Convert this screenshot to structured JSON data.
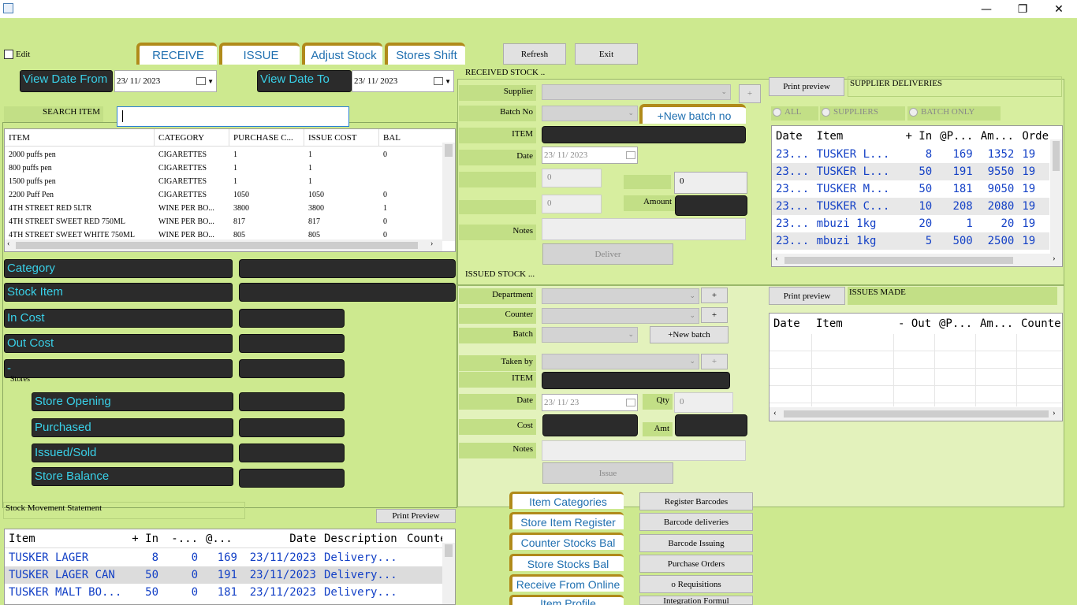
{
  "edit_label": "Edit",
  "tabs": [
    {
      "label": "RECEIVE"
    },
    {
      "label": "ISSUE"
    },
    {
      "label": "Adjust Stock"
    },
    {
      "label": "Stores Shift"
    }
  ],
  "top_buttons": {
    "refresh": "Refresh",
    "exit": "Exit"
  },
  "view_date_from": {
    "label": "View Date From",
    "value": "23/ 11/ 2023"
  },
  "view_date_to": {
    "label": "View Date To",
    "value": "23/ 11/ 2023"
  },
  "search_item": {
    "label": "SEARCH ITEM",
    "value": ""
  },
  "item_grid": {
    "columns": [
      "ITEM",
      "CATEGORY",
      "PURCHASE C...",
      "ISSUE COST",
      "BAL"
    ],
    "rows": [
      [
        "2000 puffs pen",
        "CIGARETTES",
        "1",
        "1",
        "0"
      ],
      [
        "800 puffs pen",
        "CIGARETTES",
        "1",
        "1",
        ""
      ],
      [
        "1500 puffs pen",
        "CIGARETTES",
        "1",
        "1",
        ""
      ],
      [
        "2200 Puff Pen",
        "CIGARETTES",
        "1050",
        "1050",
        "0"
      ],
      [
        "4TH STREET RED 5LTR",
        "WINE PER BO...",
        "3800",
        "3800",
        "1"
      ],
      [
        "4TH STREET SWEET RED 750ML",
        "WINE PER BO...",
        "817",
        "817",
        "0"
      ],
      [
        "4TH STREET SWEET WHITE 750ML",
        "WINE PER BO...",
        "805",
        "805",
        "0"
      ]
    ]
  },
  "detail_labels": {
    "category": "Category",
    "stock_item": "Stock Item",
    "in_cost": "In Cost",
    "out_cost": "Out Cost",
    "dash": "-",
    "stores": "Stores",
    "store_opening": "Store Opening",
    "purchased": "Purchased",
    "issued_sold": "Issued/Sold",
    "store_balance": "Store Balance"
  },
  "stock_movement": {
    "label": "Stock Movement Statement",
    "print_preview": "Print Preview",
    "columns": [
      "Item",
      "+ In",
      "-...",
      "@...",
      "Date",
      "Description",
      "Counte"
    ],
    "rows": [
      [
        "TUSKER LAGER",
        "8",
        "0",
        "169",
        "23/11/2023",
        "Delivery..."
      ],
      [
        "TUSKER LAGER CAN",
        "50",
        "0",
        "191",
        "23/11/2023",
        "Delivery..."
      ],
      [
        "TUSKER MALT BO...",
        "50",
        "0",
        "181",
        "23/11/2023",
        "Delivery..."
      ]
    ]
  },
  "received_stock": {
    "title": "RECEIVED STOCK ..",
    "supplier": "Supplier",
    "batch_no": "Batch No",
    "new_batch_no": "+New batch no",
    "item": "ITEM",
    "date": "Date",
    "date_value": "23/ 11/ 2023",
    "zero1": "0",
    "zero2": "0",
    "zero3": "0",
    "amount": "Amount",
    "notes": "Notes",
    "deliver": "Deliver",
    "plus": "+"
  },
  "supplier_deliveries": {
    "print_preview": "Print preview",
    "title": "SUPPLIER DELIVERIES",
    "radio_all": "ALL",
    "radio_suppliers": "SUPPLIERS",
    "radio_batch": "BATCH ONLY",
    "columns": [
      "Date",
      "Item",
      "+ In",
      "@P...",
      "Am...",
      "Orde"
    ],
    "rows": [
      [
        "23...",
        "TUSKER L...",
        "8",
        "169",
        "1352",
        "19"
      ],
      [
        "23...",
        "TUSKER L...",
        "50",
        "191",
        "9550",
        "19"
      ],
      [
        "23...",
        "TUSKER M...",
        "50",
        "181",
        "9050",
        "19"
      ],
      [
        "23...",
        "TUSKER C...",
        "10",
        "208",
        "2080",
        "19"
      ],
      [
        "23...",
        "mbuzi 1kg",
        "20",
        "1",
        "20",
        "19"
      ],
      [
        "23...",
        "mbuzi 1kg",
        "5",
        "500",
        "2500",
        "19"
      ]
    ]
  },
  "issued_stock": {
    "title": "ISSUED STOCK ...",
    "department": "Department",
    "counter": "Counter",
    "batch": "Batch",
    "new_batch": "+New batch",
    "taken_by": "Taken by",
    "item": "ITEM",
    "date": "Date",
    "date_value": "23/ 11/ 23",
    "qty": "Qty",
    "qty_value": "0",
    "cost": "Cost",
    "amt": "Amt",
    "notes": "Notes",
    "issue": "Issue",
    "plus": "+"
  },
  "issues_made": {
    "print_preview": "Print preview",
    "title": "ISSUES MADE",
    "columns": [
      "Date",
      "Item",
      "- Out",
      "@P...",
      "Am...",
      "Counter"
    ]
  },
  "side_links": [
    "Item Categories",
    "Store Item Register",
    "Counter Stocks Bal",
    "Store Stocks Bal",
    "Receive From Online",
    "Item Profile"
  ],
  "side_buttons": [
    "Register Barcodes",
    "Barcode deliveries",
    "Barcode Issuing",
    "Purchase Orders",
    "o Requisitions",
    "Integration Formul"
  ]
}
